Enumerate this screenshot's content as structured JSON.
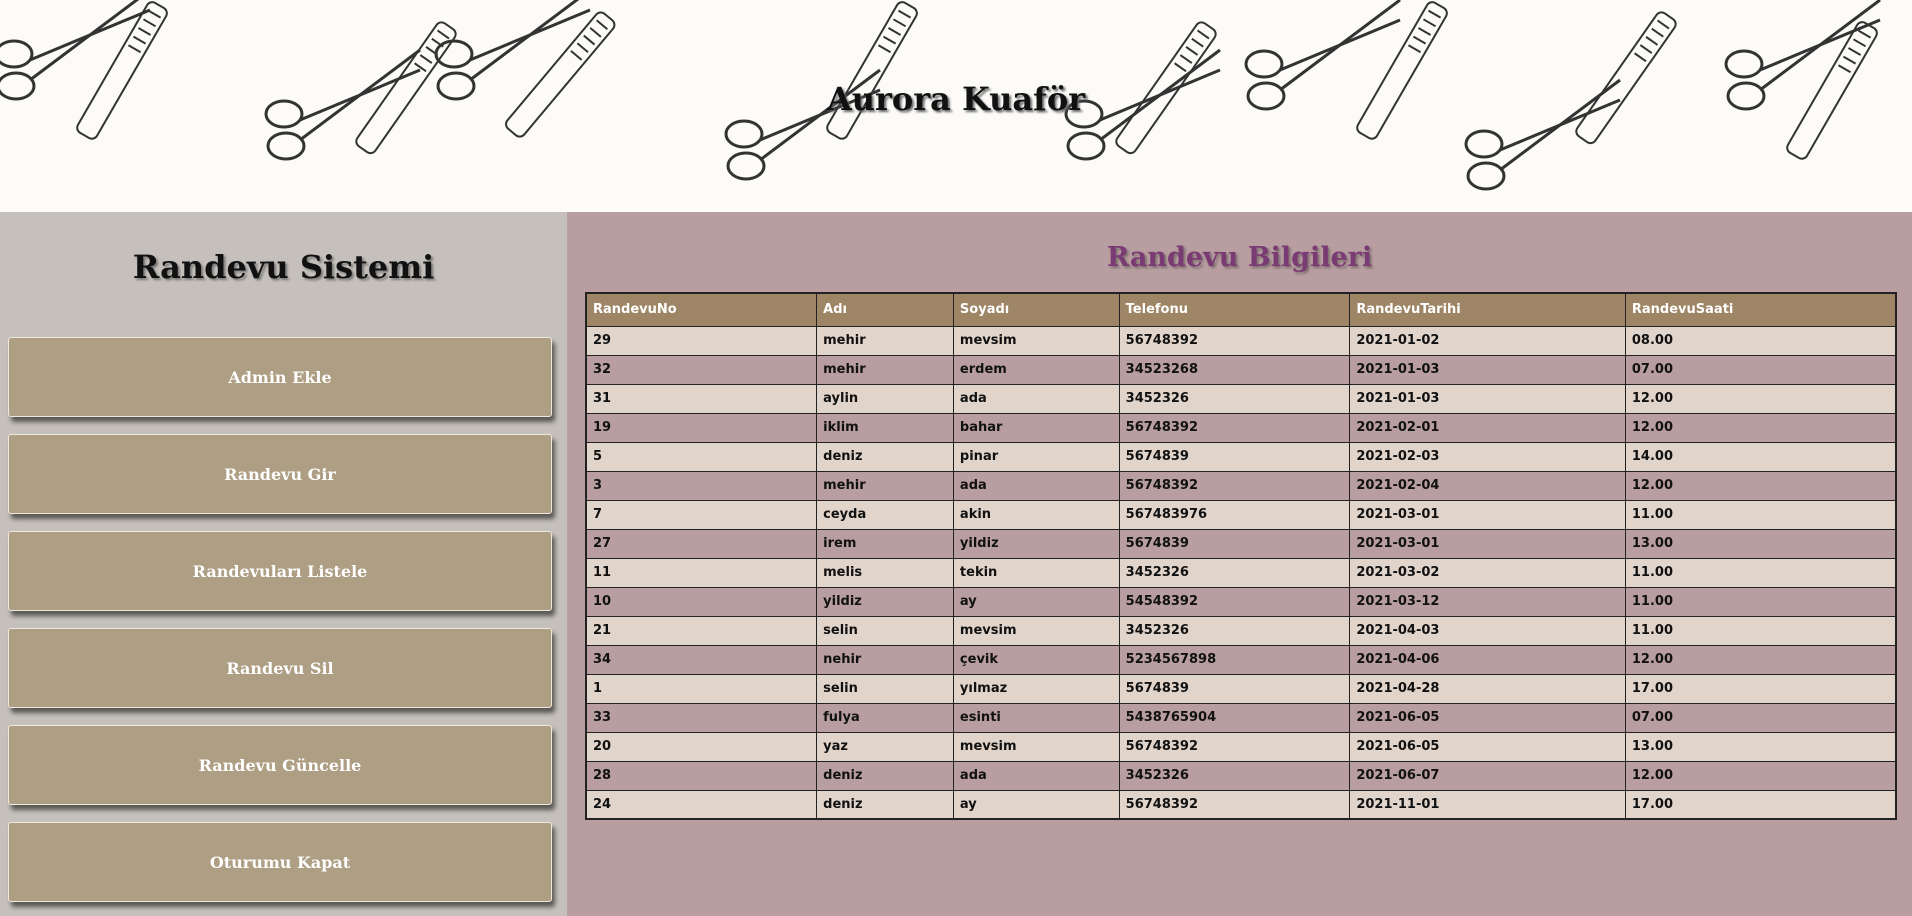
{
  "site": {
    "title": "Aurora Kuaför"
  },
  "sidebar": {
    "title": "Randevu Sistemi",
    "buttons": [
      {
        "label": "Admin Ekle"
      },
      {
        "label": "Randevu Gir"
      },
      {
        "label": "Randevuları Listele"
      },
      {
        "label": "Randevu Sil"
      },
      {
        "label": "Randevu Güncelle"
      },
      {
        "label": "Oturumu Kapat"
      }
    ]
  },
  "main": {
    "title": "Randevu Bilgileri",
    "columns": [
      "RandevuNo",
      "Adı",
      "Soyadı",
      "Telefonu",
      "RandevuTarihi",
      "RandevuSaati"
    ],
    "rows": [
      [
        "29",
        "mehir",
        "mevsim",
        "56748392",
        "2021-01-02",
        "08.00"
      ],
      [
        "32",
        "mehir",
        "erdem",
        "34523268",
        "2021-01-03",
        "07.00"
      ],
      [
        "31",
        "aylin",
        "ada",
        "3452326",
        "2021-01-03",
        "12.00"
      ],
      [
        "19",
        "iklim",
        "bahar",
        "56748392",
        "2021-02-01",
        "12.00"
      ],
      [
        "5",
        "deniz",
        "pinar",
        "5674839",
        "2021-02-03",
        "14.00"
      ],
      [
        "3",
        "mehir",
        "ada",
        "56748392",
        "2021-02-04",
        "12.00"
      ],
      [
        "7",
        "ceyda",
        "akin",
        "567483976",
        "2021-03-01",
        "11.00"
      ],
      [
        "27",
        "irem",
        "yildiz",
        "5674839",
        "2021-03-01",
        "13.00"
      ],
      [
        "11",
        "melis",
        "tekin",
        "3452326",
        "2021-03-02",
        "11.00"
      ],
      [
        "10",
        "yildiz",
        "ay",
        "54548392",
        "2021-03-12",
        "11.00"
      ],
      [
        "21",
        "selin",
        "mevsim",
        "3452326",
        "2021-04-03",
        "11.00"
      ],
      [
        "34",
        "nehir",
        "çevik",
        "5234567898",
        "2021-04-06",
        "12.00"
      ],
      [
        "1",
        "selin",
        "yılmaz",
        "5674839",
        "2021-04-28",
        "17.00"
      ],
      [
        "33",
        "fulya",
        "esinti",
        "5438765904",
        "2021-06-05",
        "07.00"
      ],
      [
        "20",
        "yaz",
        "mevsim",
        "56748392",
        "2021-06-05",
        "13.00"
      ],
      [
        "28",
        "deniz",
        "ada",
        "3452326",
        "2021-06-07",
        "12.00"
      ],
      [
        "24",
        "deniz",
        "ay",
        "56748392",
        "2021-11-01",
        "17.00"
      ]
    ]
  }
}
